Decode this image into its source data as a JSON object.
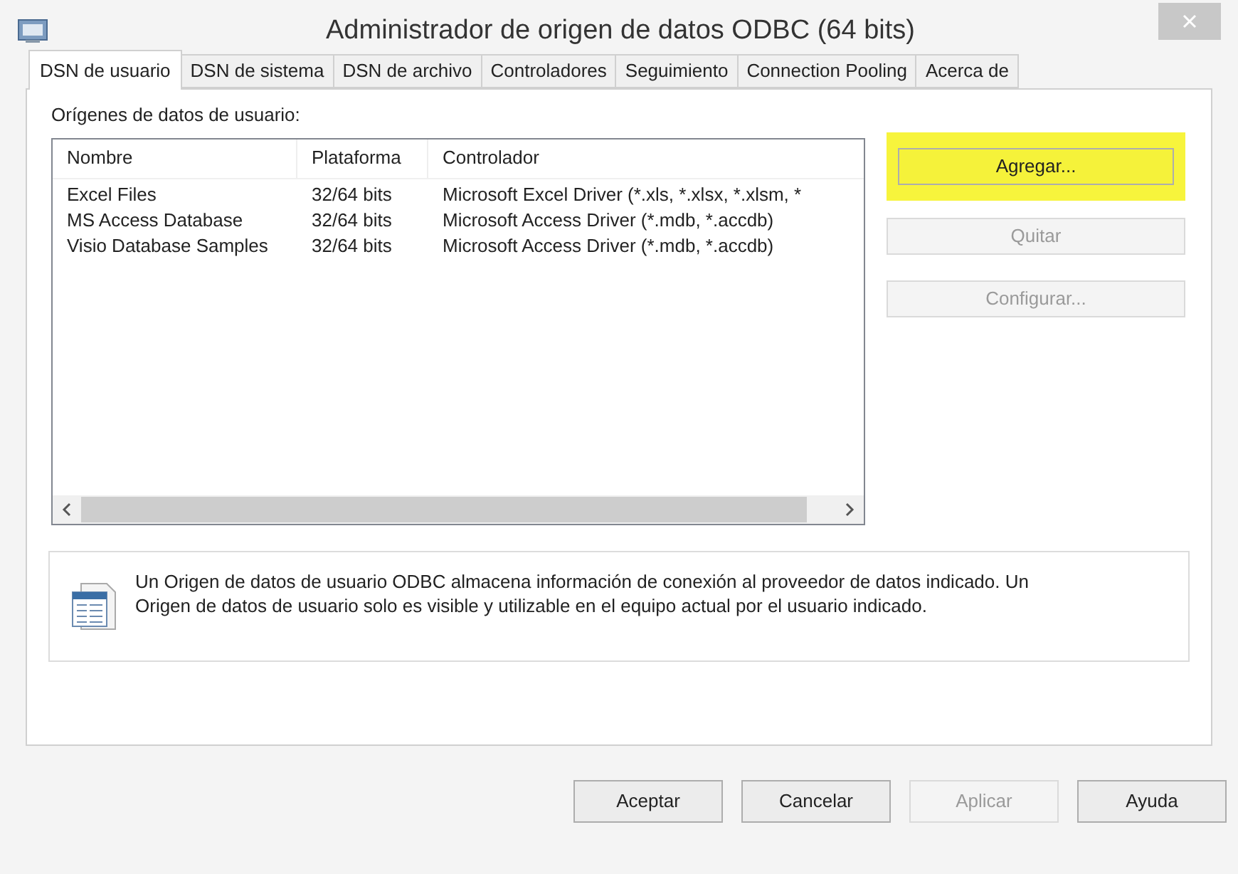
{
  "window": {
    "title": "Administrador de origen de datos ODBC (64 bits)"
  },
  "tabs": [
    {
      "label": "DSN de usuario",
      "selected": true
    },
    {
      "label": "DSN de sistema",
      "selected": false
    },
    {
      "label": "DSN de archivo",
      "selected": false
    },
    {
      "label": "Controladores",
      "selected": false
    },
    {
      "label": "Seguimiento",
      "selected": false
    },
    {
      "label": "Connection Pooling",
      "selected": false
    },
    {
      "label": "Acerca de",
      "selected": false
    }
  ],
  "list_label": "Orígenes de datos de usuario:",
  "table": {
    "columns": [
      "Nombre",
      "Plataforma",
      "Controlador"
    ],
    "rows": [
      [
        "Excel Files",
        "32/64 bits",
        "Microsoft Excel Driver (*.xls, *.xlsx, *.xlsm, *"
      ],
      [
        "MS Access Database",
        "32/64 bits",
        "Microsoft Access Driver (*.mdb, *.accdb)"
      ],
      [
        "Visio Database Samples",
        "32/64 bits",
        "Microsoft Access Driver (*.mdb, *.accdb)"
      ]
    ]
  },
  "side_buttons": [
    {
      "label": "Agregar...",
      "disabled": false,
      "highlighted": true
    },
    {
      "label": "Quitar",
      "disabled": true,
      "highlighted": false
    },
    {
      "label": "Configurar...",
      "disabled": true,
      "highlighted": false
    }
  ],
  "info": "Un Origen de datos de usuario ODBC almacena información de conexión al proveedor de datos indicado. Un Origen de datos de usuario solo es visible y utilizable en el equipo actual por el usuario indicado.",
  "buttons": [
    {
      "label": "Aceptar",
      "disabled": false
    },
    {
      "label": "Cancelar",
      "disabled": false
    },
    {
      "label": "Aplicar",
      "disabled": true
    },
    {
      "label": "Ayuda",
      "disabled": false
    }
  ]
}
